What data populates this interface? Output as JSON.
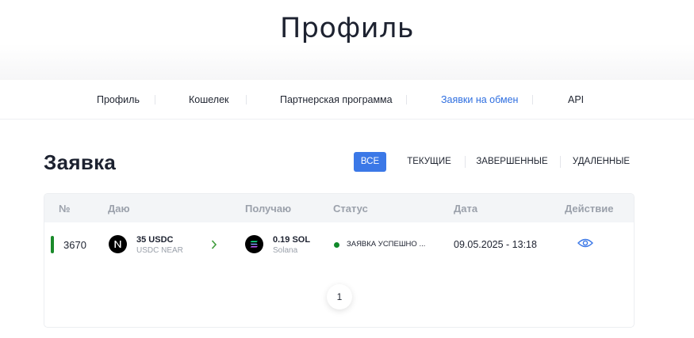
{
  "header": {
    "title": "Профиль"
  },
  "nav": {
    "items": [
      {
        "label": "Профиль"
      },
      {
        "label": "Кошелек"
      },
      {
        "label": "Партнерская программа"
      },
      {
        "label": "Заявки на обмен",
        "active": true
      },
      {
        "label": "API"
      }
    ]
  },
  "orders": {
    "title": "Заявка",
    "filters": [
      {
        "label": "ВСЕ",
        "active": true
      },
      {
        "label": "ТЕКУЩИЕ"
      },
      {
        "label": "ЗАВЕРШЕННЫЕ"
      },
      {
        "label": "УДАЛЕННЫЕ"
      }
    ],
    "columns": [
      "№",
      "Даю",
      "Получаю",
      "Статус",
      "Дата",
      "Действие"
    ],
    "rows": [
      {
        "id": "3670",
        "give": {
          "amount": "35 USDC",
          "network": "USDC NEAR",
          "icon": "near-icon"
        },
        "receive": {
          "amount": "0.19 SOL",
          "network": "Solana",
          "icon": "solana-icon"
        },
        "status": "ЗАЯВКА УСПЕШНО ...",
        "date": "09.05.2025 - 13:18",
        "action_icon": "eye-icon"
      }
    ],
    "pagination": {
      "current": "1"
    }
  },
  "colors": {
    "accent": "#3b78e7",
    "active_nav": "#2f6fe0",
    "status_success": "#10892a",
    "row_marker": "#1a8a2a"
  }
}
